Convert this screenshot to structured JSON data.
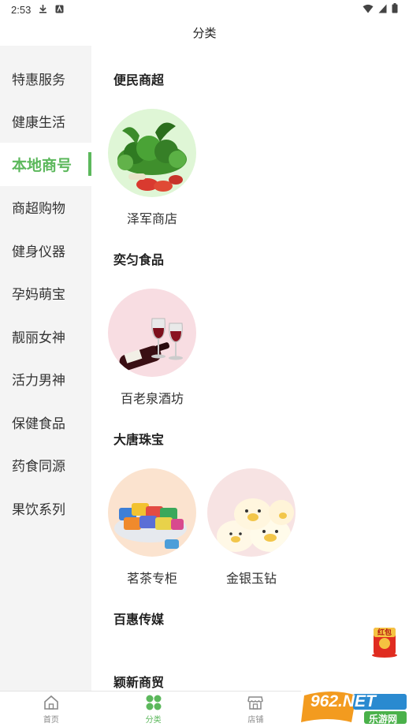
{
  "status_bar": {
    "time": "2:53"
  },
  "header": {
    "title": "分类"
  },
  "sidebar": {
    "items": [
      {
        "label": "特惠服务",
        "active": false
      },
      {
        "label": "健康生活",
        "active": false
      },
      {
        "label": "本地商号",
        "active": true
      },
      {
        "label": "商超购物",
        "active": false
      },
      {
        "label": "健身仪器",
        "active": false
      },
      {
        "label": "孕妈萌宝",
        "active": false
      },
      {
        "label": "靓丽女神",
        "active": false
      },
      {
        "label": "活力男神",
        "active": false
      },
      {
        "label": "保健食品",
        "active": false
      },
      {
        "label": "药食同源",
        "active": false
      },
      {
        "label": "果饮系列",
        "active": false
      }
    ]
  },
  "main": {
    "sections": [
      {
        "title": "便民商超",
        "shops": [
          {
            "name": "泽军商店",
            "image": "vegetables"
          }
        ]
      },
      {
        "title": "奕匀食品",
        "shops": [
          {
            "name": "百老泉酒坊",
            "image": "wine"
          }
        ]
      },
      {
        "title": "大唐珠宝",
        "shops": [
          {
            "name": "茗茶专柜",
            "image": "candy"
          },
          {
            "name": "金银玉钻",
            "image": "piggy-buns"
          }
        ]
      },
      {
        "title": "百惠传媒",
        "shops": []
      },
      {
        "title": "颖新商贸",
        "shops": []
      }
    ]
  },
  "bottom_nav": {
    "items": [
      {
        "label": "首页",
        "icon": "home-icon",
        "active": false
      },
      {
        "label": "分类",
        "icon": "grid-icon",
        "active": true
      },
      {
        "label": "店铺",
        "icon": "store-icon",
        "active": false
      }
    ]
  },
  "float_badge": {
    "text": "红包"
  },
  "watermark": {
    "brand": "962.NET",
    "sub": "乐游网"
  },
  "colors": {
    "accent": "#5cb85c",
    "sidebar_bg": "#f4f4f4"
  }
}
